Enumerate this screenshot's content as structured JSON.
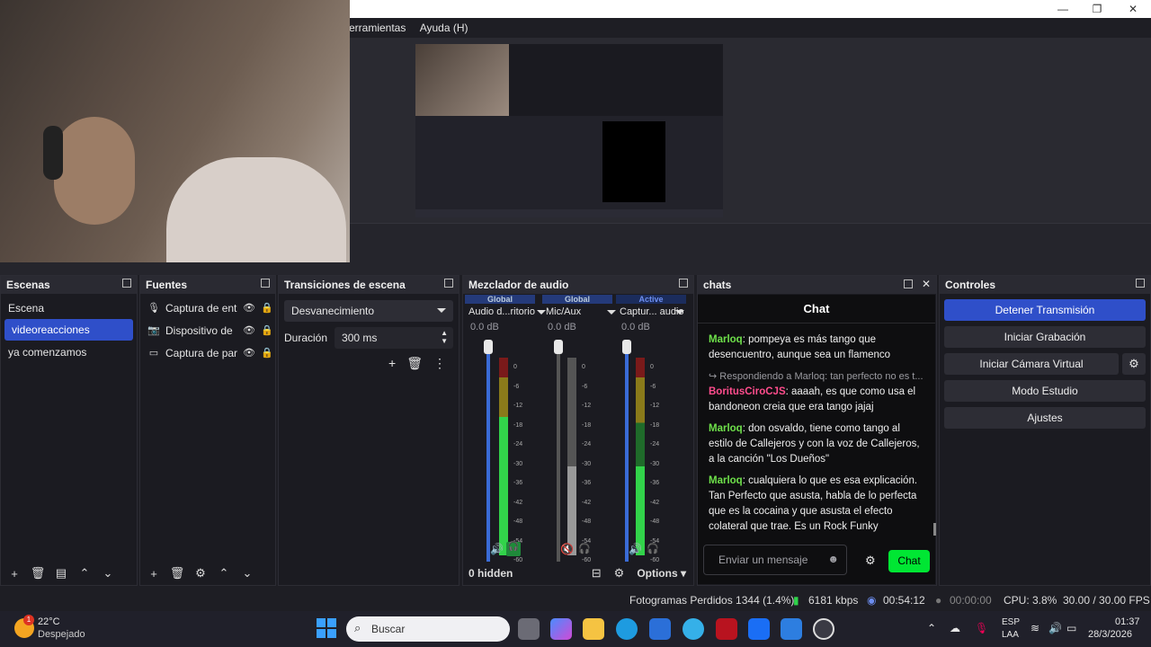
{
  "window": {
    "minimize": "—",
    "maximize": "❐",
    "close": "✕"
  },
  "menu": [
    "erramientas",
    "Ayuda (H)"
  ],
  "docks": {
    "scenes": {
      "title": "Escenas",
      "items": [
        "Escena",
        "videoreacciones",
        "ya comenzamos"
      ],
      "selected_index": 1
    },
    "sources": {
      "title": "Fuentes",
      "items": [
        "Captura de ent",
        "Dispositivo de",
        "Captura de par"
      ]
    },
    "transitions": {
      "title": "Transiciones de escena",
      "selected": "Desvanecimiento",
      "duration_label": "Duración",
      "duration_value": "300 ms"
    },
    "mixer": {
      "title": "Mezclador de audio",
      "channels": [
        {
          "tag": "Global",
          "name": "Audio d...ritorio",
          "db": "0.0 dB",
          "level": 0.7,
          "color": "#3a6bd6"
        },
        {
          "tag": "Global",
          "name": "Mic/Aux",
          "db": "0.0 dB",
          "level": 0.45,
          "color": "#2d5ab8"
        },
        {
          "tag": "Active",
          "name": "Captur... audio",
          "db": "0.0 dB",
          "level": 0.45,
          "color": "#2d5ab8"
        }
      ],
      "ticks": [
        "0",
        "-6",
        "-12",
        "-18",
        "-24",
        "-30",
        "-36",
        "-42",
        "-48",
        "-54",
        "-60"
      ],
      "hidden": "0 hidden",
      "options": "Options"
    },
    "chats": {
      "title": "chats",
      "close": "✕"
    },
    "controls": {
      "title": "Controles",
      "buttons": [
        "Detener Transmisión",
        "Iniciar Grabación",
        "Iniciar Cámara Virtual",
        "Modo Estudio",
        "Ajustes"
      ]
    }
  },
  "chat": {
    "title": "Chat",
    "messages": [
      {
        "user": "Marloq",
        "color": "#6ee04a",
        "reply": "",
        "text": "pompeya es más tango que desencuentro, aunque sea un flamenco"
      },
      {
        "user": "BoritusCiroCJS",
        "color": "#ff4d8d",
        "reply": "Respondiendo a Marloq: tan perfecto no es t...",
        "text": "aaaah, es que como usa el bandoneon creia que era tango jajaj"
      },
      {
        "user": "Marloq",
        "color": "#6ee04a",
        "reply": "",
        "text": "don osvaldo, tiene como tango al estilo de Callejeros y con la voz de Callejeros, a la canción \"Los Dueños\""
      },
      {
        "user": "Marloq",
        "color": "#6ee04a",
        "reply": "",
        "text": "cualquiera lo que es esa explicación. Tan Perfecto que asusta, habla de lo perfecta que es la cocaina y que asusta el efecto colateral que trae. Es un Rock Funky"
      }
    ],
    "input_placeholder": "Enviar un mensaje",
    "send_label": "Chat"
  },
  "status": {
    "dropped": "Fotogramas Perdidos 1344 (1.4%)",
    "bitrate": "6181 kbps",
    "stream_time": "00:54:12",
    "rec_time": "00:00:00",
    "cpu": "CPU: 3.8%",
    "fps": "30.00 / 30.00 FPS"
  },
  "taskbar": {
    "weather_temp": "22°C",
    "weather_desc": "Despejado",
    "badge": "1",
    "search_placeholder": "Buscar",
    "lang1": "ESP",
    "lang2": "LAA",
    "time": "01:37",
    "date": "28/3/2026"
  }
}
